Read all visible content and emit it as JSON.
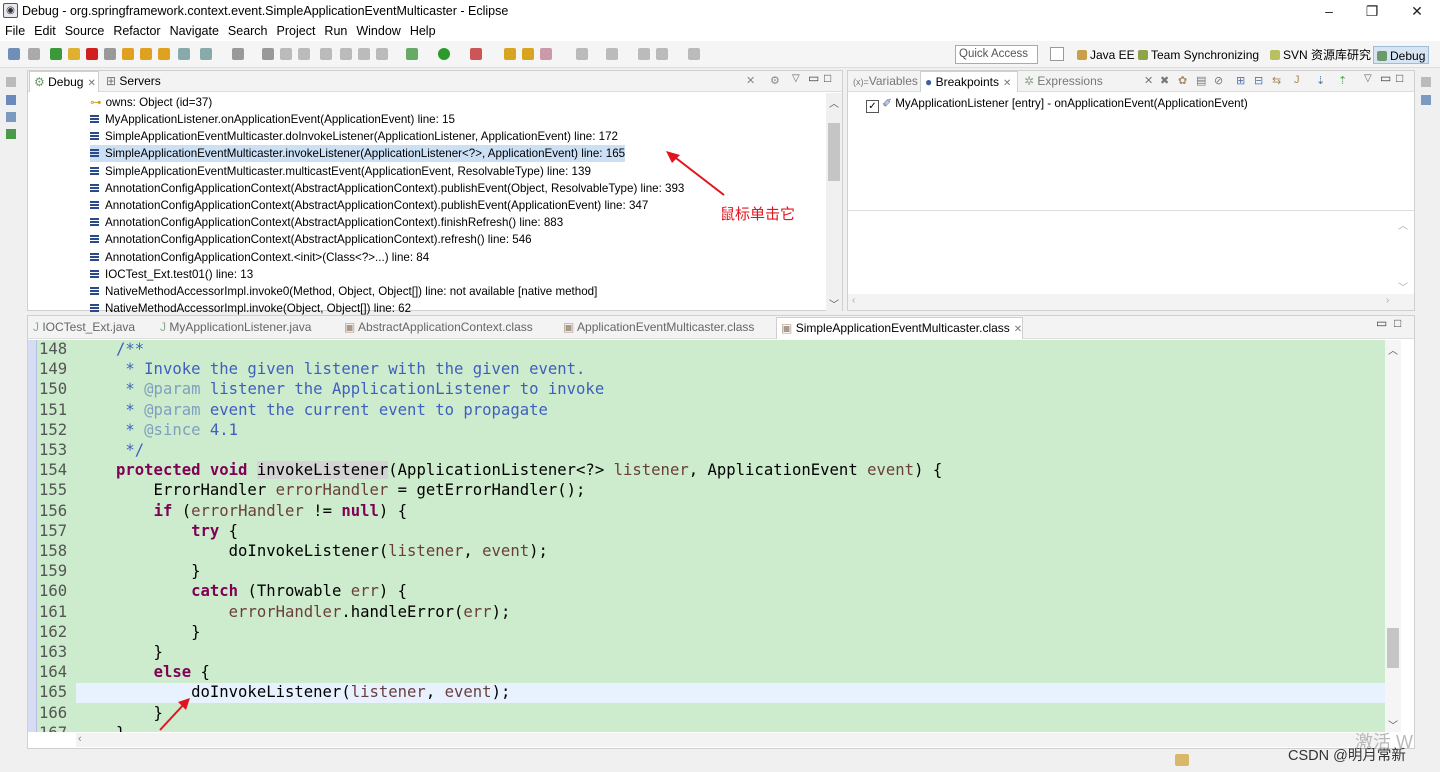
{
  "window": {
    "title": "Debug - org.springframework.context.event.SimpleApplicationEventMulticaster - Eclipse",
    "minimize": "–",
    "restore": "❐",
    "close": "✕"
  },
  "menu": [
    "File",
    "Edit",
    "Source",
    "Refactor",
    "Navigate",
    "Search",
    "Project",
    "Run",
    "Window",
    "Help"
  ],
  "toolbar": {
    "quick_access_placeholder": "Quick Access",
    "perspectives": [
      "Java EE",
      "Team Synchronizing",
      "SVN 资源库研究",
      "Debug"
    ],
    "accent": "#3b73b9"
  },
  "debug_view": {
    "tabs": [
      {
        "label": "Debug",
        "active": true
      },
      {
        "label": "Servers",
        "active": false
      }
    ],
    "owns_line": "owns: Object  (id=37)",
    "frames": [
      "MyApplicationListener.onApplicationEvent(ApplicationEvent) line: 15",
      "SimpleApplicationEventMulticaster.doInvokeListener(ApplicationListener, ApplicationEvent) line: 172",
      "SimpleApplicationEventMulticaster.invokeListener(ApplicationListener<?>, ApplicationEvent) line: 165",
      "SimpleApplicationEventMulticaster.multicastEvent(ApplicationEvent, ResolvableType) line: 139",
      "AnnotationConfigApplicationContext(AbstractApplicationContext).publishEvent(Object, ResolvableType) line: 393",
      "AnnotationConfigApplicationContext(AbstractApplicationContext).publishEvent(ApplicationEvent) line: 347",
      "AnnotationConfigApplicationContext(AbstractApplicationContext).finishRefresh() line: 883",
      "AnnotationConfigApplicationContext(AbstractApplicationContext).refresh() line: 546",
      "AnnotationConfigApplicationContext.<init>(Class<?>...) line: 84",
      "IOCTest_Ext.test01() line: 13",
      "NativeMethodAccessorImpl.invoke0(Method, Object, Object[]) line: not available [native method]",
      "NativeMethodAccessorImpl.invoke(Object, Object[]) line: 62"
    ],
    "selected_index": 2,
    "annotation": "鼠标单击它"
  },
  "breakpoints_view": {
    "tabs": [
      {
        "label": "Variables",
        "active": false
      },
      {
        "label": "Breakpoints",
        "active": true
      },
      {
        "label": "Expressions",
        "active": false
      }
    ],
    "items": [
      "MyApplicationListener [entry] - onApplicationEvent(ApplicationEvent)"
    ]
  },
  "editor": {
    "tabs": [
      {
        "label": "IOCTest_Ext.java",
        "active": false
      },
      {
        "label": "MyApplicationListener.java",
        "active": false
      },
      {
        "label": "AbstractApplicationContext.class",
        "active": false
      },
      {
        "label": "ApplicationEventMulticaster.class",
        "active": false
      },
      {
        "label": "SimpleApplicationEventMulticaster.class",
        "active": true
      }
    ],
    "line_numbers": [
      "148",
      "149",
      "150",
      "151",
      "152",
      "153",
      "154",
      "155",
      "156",
      "157",
      "158",
      "159",
      "160",
      "161",
      "162",
      "163",
      "164",
      "165",
      "166",
      "167"
    ],
    "current_line": "165"
  },
  "watermark": "CSDN @明月常新",
  "watermark2": "激活 W"
}
